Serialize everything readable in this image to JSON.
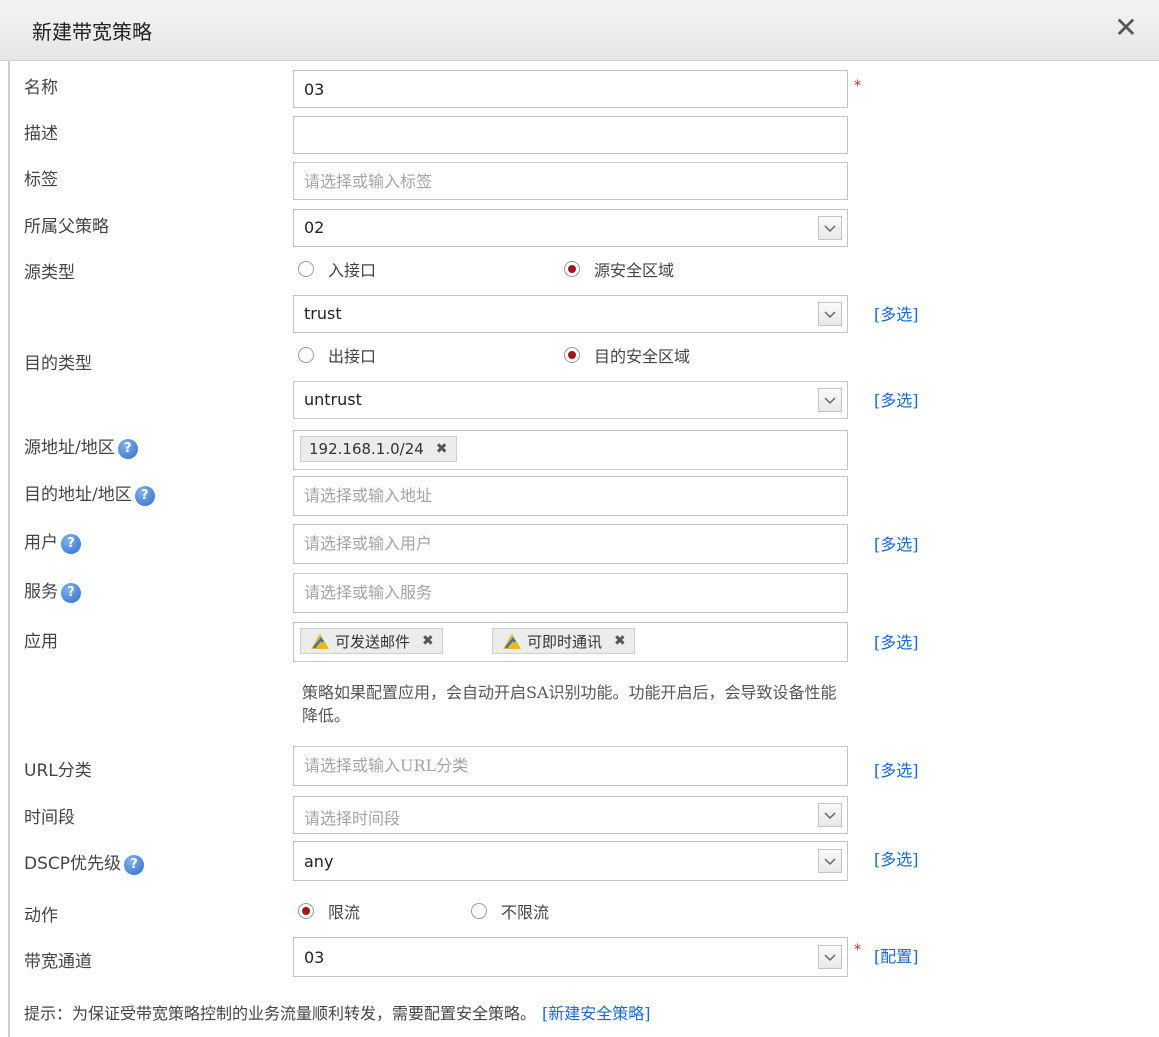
{
  "dialog": {
    "title": "新建带宽策略",
    "close": "✕"
  },
  "form": {
    "name": {
      "label": "名称",
      "value": "03"
    },
    "desc": {
      "label": "描述",
      "value": ""
    },
    "tags": {
      "label": "标签",
      "placeholder": "请选择或输入标签"
    },
    "parent": {
      "label": "所属父策略",
      "value": "02"
    },
    "src_type": {
      "label": "源类型",
      "opt1": "入接口",
      "opt2": "源安全区域",
      "selected": "源安全区域"
    },
    "src_zone": {
      "value": "trust",
      "multi": "[多选]"
    },
    "dst_type": {
      "label": "目的类型",
      "opt1": "出接口",
      "opt2": "目的安全区域",
      "selected": "目的安全区域"
    },
    "dst_zone": {
      "value": "untrust",
      "multi": "[多选]"
    },
    "src_addr": {
      "label": "源地址/地区",
      "tags": [
        "192.168.1.0/24"
      ]
    },
    "dst_addr": {
      "label": "目的地址/地区",
      "placeholder": "请选择或输入地址"
    },
    "user": {
      "label": "用户",
      "placeholder": "请选择或输入用户",
      "multi": "[多选]"
    },
    "service": {
      "label": "服务",
      "placeholder": "请选择或输入服务"
    },
    "app": {
      "label": "应用",
      "tags": [
        "可发送邮件",
        "可即时通讯"
      ],
      "multi": "[多选]"
    },
    "app_note": "策略如果配置应用，会自动开启SA识别功能。功能开启后，会导致设备性能降低。",
    "url": {
      "label_prefix": "URL",
      "label_suffix": "分类",
      "placeholder": "请选择或输入URL分类",
      "multi": "[多选]"
    },
    "time": {
      "label": "时间段",
      "placeholder": "请选择时间段"
    },
    "dscp": {
      "label_prefix": "DSCP",
      "label_suffix": "优先级",
      "value": "any",
      "multi": "[多选]"
    },
    "action": {
      "label": "动作",
      "opt1": "限流",
      "opt2": "不限流",
      "selected": "限流"
    },
    "channel": {
      "label": "带宽通道",
      "value": "03",
      "config": "[配置]"
    },
    "required_mark": "*",
    "help_glyph": "?",
    "tag_close": "✖"
  },
  "hint": {
    "text": "提示：为保证受带宽策略控制的业务流量顺利转发，需要配置安全策略。",
    "link": "[新建安全策略]"
  },
  "colors": {
    "link": "#1a6ad1",
    "radio_selected": "#a01818",
    "required": "#dd2222",
    "help_icon": "#2f6fc4"
  }
}
